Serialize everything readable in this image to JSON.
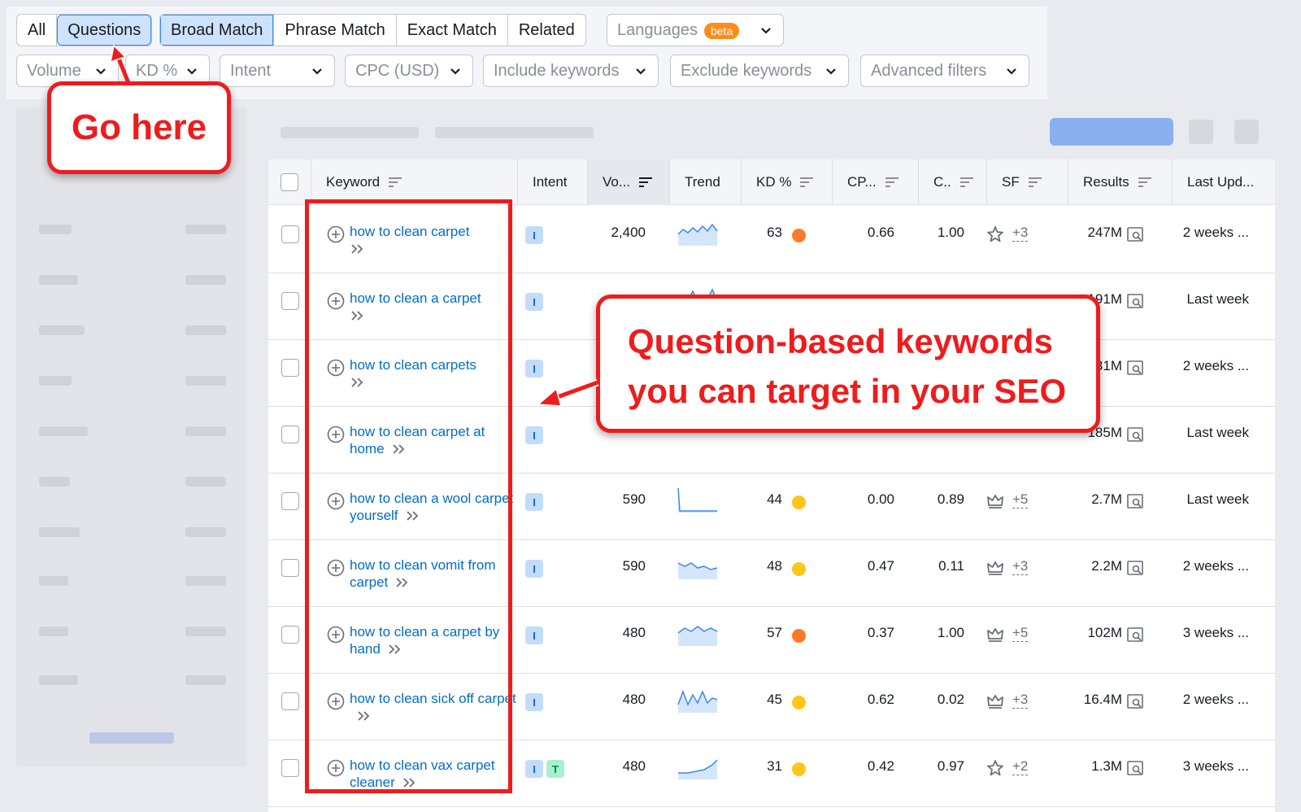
{
  "match_tabs": [
    "All",
    "Questions",
    "Broad Match",
    "Phrase Match",
    "Exact Match",
    "Related"
  ],
  "languages": {
    "label": "Languages",
    "badge": "beta"
  },
  "filters": [
    "Volume",
    "KD %",
    "Intent",
    "CPC (USD)",
    "Include keywords",
    "Exclude keywords",
    "Advanced filters"
  ],
  "columns": [
    "Keyword",
    "Intent",
    "Vo...",
    "Trend",
    "KD %",
    "CP...",
    "C..",
    "SF",
    "Results",
    "Last Upd..."
  ],
  "rows": [
    {
      "keyword": "how to clean carpet",
      "intent": [
        "I"
      ],
      "volume": "2,400",
      "kd": "63",
      "kd_color": "#ff7a28",
      "cpc": "0.66",
      "com": "1.00",
      "sf_icon": "star-icon",
      "sf_more": "+3",
      "results": "247M",
      "updated": "2 weeks ..."
    },
    {
      "keyword": "how to clean a carpet",
      "intent": [
        "I"
      ],
      "volume": "",
      "kd": "",
      "kd_color": "",
      "cpc": "",
      "com": "",
      "sf_icon": "",
      "sf_more": "",
      "results": "191M",
      "updated": "Last week"
    },
    {
      "keyword": "how to clean carpets",
      "intent": [
        "I"
      ],
      "volume": "",
      "kd": "",
      "kd_color": "",
      "cpc": "",
      "com": "",
      "sf_icon": "",
      "sf_more": "",
      "results": "31M",
      "updated": "2 weeks ..."
    },
    {
      "keyword": "how to clean carpet at home",
      "intent": [
        "I"
      ],
      "volume": "",
      "kd": "",
      "kd_color": "",
      "cpc": "",
      "com": "",
      "sf_icon": "",
      "sf_more": "",
      "results": "185M",
      "updated": "Last week"
    },
    {
      "keyword": "how to clean a wool carpet yourself",
      "intent": [
        "I"
      ],
      "volume": "590",
      "kd": "44",
      "kd_color": "#ffc61a",
      "cpc": "0.00",
      "com": "0.89",
      "sf_icon": "crown-icon",
      "sf_more": "+5",
      "results": "2.7M",
      "updated": "Last week"
    },
    {
      "keyword": "how to clean vomit from carpet",
      "intent": [
        "I"
      ],
      "volume": "590",
      "kd": "48",
      "kd_color": "#ffc61a",
      "cpc": "0.47",
      "com": "0.11",
      "sf_icon": "crown-icon",
      "sf_more": "+3",
      "results": "2.2M",
      "updated": "2 weeks ..."
    },
    {
      "keyword": "how to clean a carpet by hand",
      "intent": [
        "I"
      ],
      "volume": "480",
      "kd": "57",
      "kd_color": "#ff7a28",
      "cpc": "0.37",
      "com": "1.00",
      "sf_icon": "crown-icon",
      "sf_more": "+5",
      "results": "102M",
      "updated": "3 weeks ..."
    },
    {
      "keyword": "how to clean sick off carpet",
      "intent": [
        "I"
      ],
      "volume": "480",
      "kd": "45",
      "kd_color": "#ffc61a",
      "cpc": "0.62",
      "com": "0.02",
      "sf_icon": "crown-icon",
      "sf_more": "+3",
      "results": "16.4M",
      "updated": "2 weeks ..."
    },
    {
      "keyword": "how to clean vax carpet cleaner",
      "intent": [
        "I",
        "T"
      ],
      "volume": "480",
      "kd": "31",
      "kd_color": "#ffc61a",
      "cpc": "0.42",
      "com": "0.97",
      "sf_icon": "star-icon",
      "sf_more": "+2",
      "results": "1.3M",
      "updated": "3 weeks ..."
    }
  ],
  "annotations": {
    "go_here": "Go here",
    "question_line1": "Question-based keywords",
    "question_line2": "you can target in your SEO"
  },
  "colors": {
    "accent": "#006dca",
    "annotation": "#ee1c1c",
    "kd_orange": "#ff7a28",
    "kd_yellow": "#ffc61a"
  }
}
